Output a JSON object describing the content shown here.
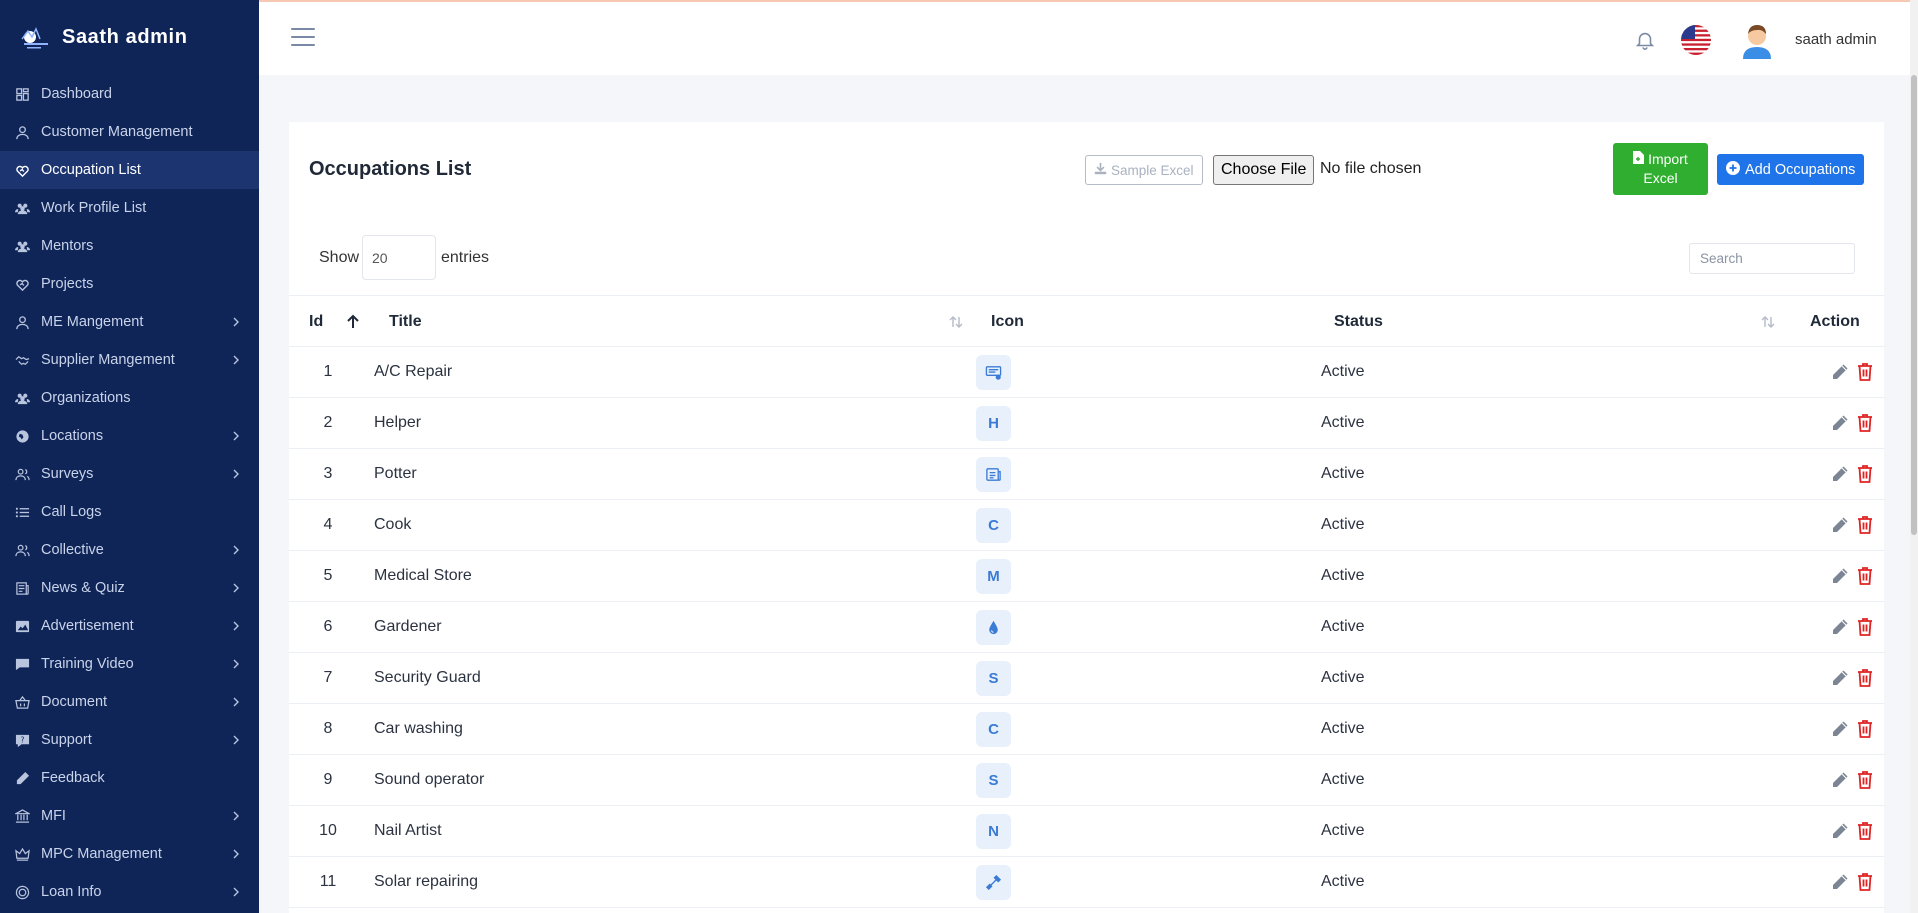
{
  "brand": {
    "name": "Saath admin",
    "logo": "saath-logo"
  },
  "sidebar": {
    "items": [
      {
        "label": "Dashboard",
        "icon": "dashboard-icon",
        "has_children": false,
        "active": false
      },
      {
        "label": "Customer Management",
        "icon": "user-icon",
        "has_children": false,
        "active": false
      },
      {
        "label": "Occupation List",
        "icon": "heart-handshake-icon",
        "has_children": false,
        "active": true
      },
      {
        "label": "Work Profile List",
        "icon": "users-icon",
        "has_children": false,
        "active": false
      },
      {
        "label": "Mentors",
        "icon": "users-icon",
        "has_children": false,
        "active": false
      },
      {
        "label": "Projects",
        "icon": "heart-handshake-icon",
        "has_children": false,
        "active": false
      },
      {
        "label": "ME Mangement",
        "icon": "user-icon",
        "has_children": true,
        "active": false
      },
      {
        "label": "Supplier Mangement",
        "icon": "handshake-icon",
        "has_children": true,
        "active": false
      },
      {
        "label": "Organizations",
        "icon": "users-icon",
        "has_children": false,
        "active": false
      },
      {
        "label": "Locations",
        "icon": "globe-icon",
        "has_children": true,
        "active": false
      },
      {
        "label": "Surveys",
        "icon": "user-group-icon",
        "has_children": true,
        "active": false
      },
      {
        "label": "Call Logs",
        "icon": "list-icon",
        "has_children": false,
        "active": false
      },
      {
        "label": "Collective",
        "icon": "user-group-icon",
        "has_children": true,
        "active": false
      },
      {
        "label": "News & Quiz",
        "icon": "news-icon",
        "has_children": true,
        "active": false
      },
      {
        "label": "Advertisement",
        "icon": "image-icon",
        "has_children": true,
        "active": false
      },
      {
        "label": "Training Video",
        "icon": "message-icon",
        "has_children": true,
        "active": false
      },
      {
        "label": "Document",
        "icon": "basket-icon",
        "has_children": true,
        "active": false
      },
      {
        "label": "Support",
        "icon": "help-icon",
        "has_children": true,
        "active": false
      },
      {
        "label": "Feedback",
        "icon": "pencil-icon",
        "has_children": false,
        "active": false
      },
      {
        "label": "MFI",
        "icon": "bank-icon",
        "has_children": true,
        "active": false
      },
      {
        "label": "MPC Management",
        "icon": "crown-icon",
        "has_children": true,
        "active": false
      },
      {
        "label": "Loan Info",
        "icon": "coin-icon",
        "has_children": true,
        "active": false
      }
    ]
  },
  "topbar": {
    "user_name": "saath admin",
    "bell_icon": "bell-icon",
    "flag_icon": "us-flag-icon",
    "avatar_icon": "avatar-icon"
  },
  "page": {
    "title": "Occupations List",
    "sample_excel": "Sample Excel",
    "choose_file": "Choose File",
    "no_file": "No file chosen",
    "import_excel_line1": "Import",
    "import_excel_line2": "Excel",
    "add_button": "Add Occupations",
    "show_label": "Show",
    "entries_value": "20",
    "entries_label": "entries",
    "search_placeholder": "Search"
  },
  "table": {
    "headers": {
      "id": "Id",
      "title": "Title",
      "icon": "Icon",
      "status": "Status",
      "action": "Action"
    },
    "rows": [
      {
        "id": "1",
        "title": "A/C Repair",
        "icon_type": "svg",
        "icon": "ac-repair-icon",
        "status": "Active"
      },
      {
        "id": "2",
        "title": "Helper",
        "icon_type": "letter",
        "icon": "H",
        "status": "Active"
      },
      {
        "id": "3",
        "title": "Potter",
        "icon_type": "svg",
        "icon": "potter-icon",
        "status": "Active"
      },
      {
        "id": "4",
        "title": "Cook",
        "icon_type": "letter",
        "icon": "C",
        "status": "Active"
      },
      {
        "id": "5",
        "title": "Medical Store",
        "icon_type": "letter",
        "icon": "M",
        "status": "Active"
      },
      {
        "id": "6",
        "title": "Gardener",
        "icon_type": "svg",
        "icon": "drop-icon",
        "status": "Active"
      },
      {
        "id": "7",
        "title": "Security Guard",
        "icon_type": "letter",
        "icon": "S",
        "status": "Active"
      },
      {
        "id": "8",
        "title": "Car washing",
        "icon_type": "letter",
        "icon": "C",
        "status": "Active"
      },
      {
        "id": "9",
        "title": "Sound operator",
        "icon_type": "letter",
        "icon": "S",
        "status": "Active"
      },
      {
        "id": "10",
        "title": "Nail Artist",
        "icon_type": "letter",
        "icon": "N",
        "status": "Active"
      },
      {
        "id": "11",
        "title": "Solar repairing",
        "icon_type": "svg",
        "icon": "tool-icon",
        "status": "Active"
      }
    ]
  },
  "colors": {
    "sidebar_bg": "#0f2557",
    "sidebar_active": "#1c3570",
    "import_green": "#2fae2f",
    "add_blue": "#1e74e8",
    "delete_red": "#e02424",
    "icon_blue": "#3a7bd5"
  }
}
